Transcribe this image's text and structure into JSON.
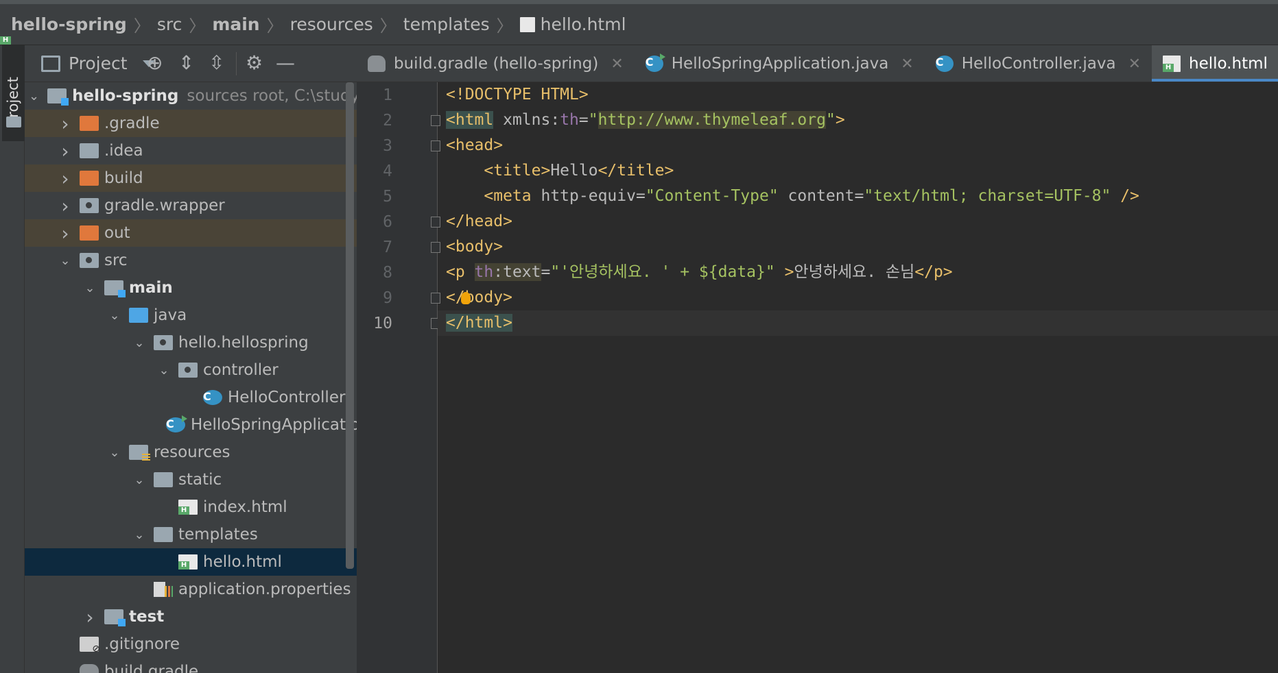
{
  "breadcrumb": [
    {
      "label": "hello-spring",
      "bold": true
    },
    {
      "label": "src"
    },
    {
      "label": "main",
      "bold": true
    },
    {
      "label": "resources"
    },
    {
      "label": "templates"
    },
    {
      "label": "hello.html",
      "icon": "html-file-icon"
    }
  ],
  "stripe": {
    "project_label": "Project"
  },
  "panel": {
    "title": "Project",
    "tree": [
      {
        "label": "hello-spring",
        "hint": "sources root,  C:\\study\\h",
        "bold": true,
        "depth": 0,
        "arrow": "down",
        "icon": "module"
      },
      {
        "label": ".gradle",
        "depth": 1,
        "arrow": "right",
        "icon": "folder-orange",
        "excluded": true
      },
      {
        "label": ".idea",
        "depth": 1,
        "arrow": "right",
        "icon": "folder"
      },
      {
        "label": "build",
        "depth": 1,
        "arrow": "right",
        "icon": "folder-orange",
        "excluded": true
      },
      {
        "label": "gradle.wrapper",
        "depth": 1,
        "arrow": "right",
        "icon": "folder-dot"
      },
      {
        "label": "out",
        "depth": 1,
        "arrow": "right",
        "icon": "folder-orange",
        "excluded": true
      },
      {
        "label": "src",
        "depth": 1,
        "arrow": "down",
        "icon": "folder-dot"
      },
      {
        "label": "main",
        "depth": 2,
        "arrow": "down",
        "icon": "folder-module",
        "bold": true
      },
      {
        "label": "java",
        "depth": 3,
        "arrow": "down",
        "icon": "folder-blue"
      },
      {
        "label": "hello.hellospring",
        "depth": 4,
        "arrow": "down",
        "icon": "folder-dot"
      },
      {
        "label": "controller",
        "depth": 5,
        "arrow": "down",
        "icon": "folder-dot"
      },
      {
        "label": "HelloController",
        "depth": 6,
        "arrow": "",
        "icon": "class"
      },
      {
        "label": "HelloSpringApplication",
        "depth": 5,
        "arrow": "",
        "icon": "class-run"
      },
      {
        "label": "resources",
        "depth": 3,
        "arrow": "down",
        "icon": "folder-res"
      },
      {
        "label": "static",
        "depth": 4,
        "arrow": "down",
        "icon": "folder"
      },
      {
        "label": "index.html",
        "depth": 5,
        "arrow": "",
        "icon": "html"
      },
      {
        "label": "templates",
        "depth": 4,
        "arrow": "down",
        "icon": "folder"
      },
      {
        "label": "hello.html",
        "depth": 5,
        "arrow": "",
        "icon": "html",
        "selected": true
      },
      {
        "label": "application.properties",
        "depth": 4,
        "arrow": "",
        "icon": "props"
      },
      {
        "label": "test",
        "depth": 2,
        "arrow": "right",
        "icon": "folder-module",
        "bold": true
      },
      {
        "label": ".gitignore",
        "depth": 1,
        "arrow": "",
        "icon": "git"
      },
      {
        "label": "build.gradle",
        "depth": 1,
        "arrow": "",
        "icon": "gradle"
      }
    ]
  },
  "tabs": [
    {
      "label": "build.gradle (hello-spring)",
      "icon": "gradle",
      "close": "✕"
    },
    {
      "label": "HelloSpringApplication.java",
      "icon": "class-run",
      "close": "✕"
    },
    {
      "label": "HelloController.java",
      "icon": "class",
      "close": "✕"
    },
    {
      "label": "hello.html",
      "icon": "html",
      "close": "✕",
      "active": true
    }
  ],
  "editor": {
    "current_line": 10,
    "lines": [
      {
        "n": "1",
        "html": [
          [
            "t",
            "<!DOCTYPE HTML>"
          ]
        ]
      },
      {
        "n": "2",
        "html": [
          [
            "t hl",
            "<html"
          ],
          [
            "a",
            " xmlns:"
          ],
          [
            "ns",
            "th"
          ],
          [
            "a",
            "="
          ],
          [
            "s",
            "\""
          ],
          [
            "s hl2",
            "http://www.thymeleaf.org"
          ],
          [
            "s",
            "\""
          ],
          [
            "t",
            ">"
          ]
        ]
      },
      {
        "n": "3",
        "html": [
          [
            "t",
            "<head>"
          ]
        ]
      },
      {
        "n": "4",
        "html": [
          [
            "a",
            "    "
          ],
          [
            "t",
            "<title>"
          ],
          [
            "tx",
            "Hello"
          ],
          [
            "t",
            "</title>"
          ]
        ]
      },
      {
        "n": "5",
        "html": [
          [
            "a",
            "    "
          ],
          [
            "t",
            "<meta"
          ],
          [
            "a",
            " http-equiv="
          ],
          [
            "s",
            "\"Content-Type\""
          ],
          [
            "a",
            " content="
          ],
          [
            "s",
            "\"text/html; charset=UTF-8\""
          ],
          [
            "t",
            " />"
          ]
        ]
      },
      {
        "n": "6",
        "html": [
          [
            "t",
            "</head>"
          ]
        ]
      },
      {
        "n": "7",
        "html": [
          [
            "t",
            "<body>"
          ]
        ]
      },
      {
        "n": "8",
        "html": [
          [
            "t",
            "<p "
          ],
          [
            "ns hl2",
            "th"
          ],
          [
            "a hl2",
            ":text"
          ],
          [
            "a",
            "="
          ],
          [
            "s",
            "\"'안녕하세요. ' + ${data}\""
          ],
          [
            "t",
            " >"
          ],
          [
            "tx",
            "안녕하세요. 손님"
          ],
          [
            "t",
            "</p>"
          ]
        ]
      },
      {
        "n": "9",
        "html": [
          [
            "t",
            "</body>"
          ]
        ]
      },
      {
        "n": "10",
        "html": [
          [
            "t hl",
            "</html>"
          ]
        ]
      }
    ]
  }
}
